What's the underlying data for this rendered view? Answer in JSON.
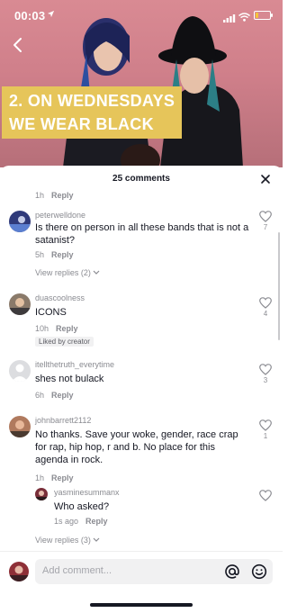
{
  "status_bar": {
    "time": "00:03",
    "battery_level": 0.2,
    "battery_color": "#f5c43a"
  },
  "video": {
    "caption_lines": [
      "2. ON WEDNESDAYS",
      "WE WEAR BLACK"
    ],
    "caption_color": "#e6c55a"
  },
  "comments_panel": {
    "count_label": "25 comments",
    "partial_reply_meta": "1h",
    "partial_reply_label": "Reply",
    "comments": [
      {
        "username": "peterwelldone",
        "text": "Is there on person in all these bands that is not a satanist?",
        "time": "5h",
        "reply_label": "Reply",
        "likes": "7",
        "view_replies": "View replies (2)"
      },
      {
        "username": "duascoolness",
        "text": "ICONS",
        "time": "10h",
        "reply_label": "Reply",
        "liked_by_creator": "Liked by creator",
        "likes": "4"
      },
      {
        "username": "itellthetruth_everytime",
        "text": "shes not bulack",
        "time": "6h",
        "reply_label": "Reply",
        "likes": "3"
      },
      {
        "username": "johnbarrett2112",
        "text": "No thanks. Save your woke, gender, race crap for rap, hip hop, r and b. No place for this agenda in rock.",
        "time": "1h",
        "reply_label": "Reply",
        "likes": "1"
      }
    ],
    "nested_reply": {
      "username": "yasminesummanx",
      "text": "Who asked?",
      "time": "1s ago",
      "reply_label": "Reply"
    },
    "view_replies_bottom": "View replies (3)"
  },
  "composer": {
    "placeholder": "Add comment...",
    "mention_icon": "at-icon",
    "emoji_icon": "emoji-icon"
  },
  "colors": {
    "text": "#161823",
    "secondary": "#8a8b91",
    "like_outline": "#8a8b91"
  }
}
